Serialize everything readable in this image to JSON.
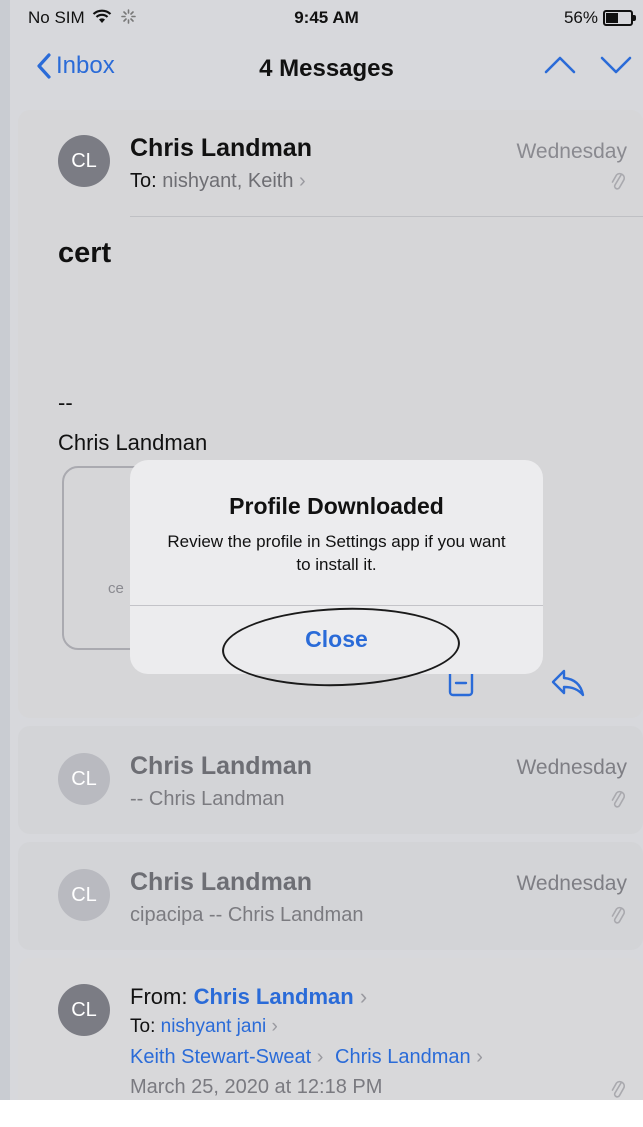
{
  "status_bar": {
    "carrier": "No SIM",
    "time": "9:45 AM",
    "battery_pct": "56%",
    "battery_level": 0.56
  },
  "navbar": {
    "back_label": "Inbox",
    "title": "4 Messages"
  },
  "messages": [
    {
      "avatar": "CL",
      "sender": "Chris Landman",
      "to_label": "To:",
      "to_value": "nishyant, Keith",
      "date": "Wednesday",
      "subject": "cert",
      "sig_dashes": "--",
      "sig_name": "Chris Landman",
      "attachment_partial": "ce"
    },
    {
      "avatar": "CL",
      "sender": "Chris Landman",
      "preview": "-- Chris Landman",
      "date": "Wednesday"
    },
    {
      "avatar": "CL",
      "sender": "Chris Landman",
      "preview": "cipacipa -- Chris Landman",
      "date": "Wednesday"
    },
    {
      "avatar": "CL",
      "from_label": "From:",
      "from_value": "Chris Landman",
      "to_label": "To:",
      "to_value": "nishyant jani",
      "cc_1": "Keith Stewart-Sweat",
      "cc_2": "Chris Landman",
      "timestamp": "March 25, 2020 at 12:18 PM"
    }
  ],
  "dialog": {
    "title": "Profile Downloaded",
    "message": "Review the profile in Settings app if you want to install it.",
    "button": "Close"
  },
  "colors": {
    "accent": "#2a6bd8"
  }
}
